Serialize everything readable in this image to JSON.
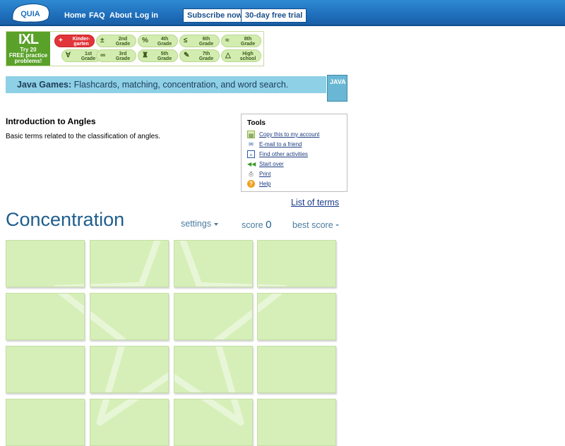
{
  "nav": {
    "logo_text": "QUIA",
    "links": [
      "Home",
      "FAQ",
      "About",
      "Log in"
    ],
    "subscribe_label": "Subscribe now",
    "trial_label": "30-day free trial"
  },
  "ixl": {
    "logo_text": "IXL",
    "promo_line1": "Try 20",
    "promo_line2": "FREE practice",
    "promo_line3": "problems!",
    "grades": [
      {
        "l1": "Kinder-",
        "l2": "garten",
        "icon": "+"
      },
      {
        "l1": "2nd",
        "l2": "Grade",
        "icon": "±"
      },
      {
        "l1": "4th",
        "l2": "Grade",
        "icon": "%"
      },
      {
        "l1": "6th",
        "l2": "Grade",
        "icon": "≤"
      },
      {
        "l1": "8th",
        "l2": "Grade",
        "icon": "≈"
      },
      {
        "l1": "1st",
        "l2": "Grade",
        "icon": "∀"
      },
      {
        "l1": "3rd",
        "l2": "Grade",
        "icon": "∞"
      },
      {
        "l1": "5th",
        "l2": "Grade",
        "icon": "♜"
      },
      {
        "l1": "7th",
        "l2": "Grade",
        "icon": "✎"
      },
      {
        "l1": "High",
        "l2": "school",
        "icon": "△"
      }
    ]
  },
  "javabar": {
    "bold": "Java Games:",
    "rest": " Flashcards, matching, concentration, and word search.",
    "icon_text": "JAVA"
  },
  "activity": {
    "title": "Introduction to Angles",
    "description": "Basic terms related to the classification of angles."
  },
  "tools": {
    "heading": "Tools",
    "items": [
      "Copy this to my account",
      "E-mail to a friend",
      "Find other activities",
      "Start over",
      "Print",
      "Help"
    ]
  },
  "list_of_terms": "List of terms",
  "game": {
    "title": "Concentration",
    "settings_label": "settings",
    "score_label": "score",
    "score_value": "0",
    "best_label": "best score",
    "best_value": "-"
  },
  "colors": {
    "card_bg": "#d6efb8",
    "nav_bg": "#1f6fbb",
    "javabar_bg": "#8ed0e6",
    "title_color": "#1f5e8c"
  }
}
